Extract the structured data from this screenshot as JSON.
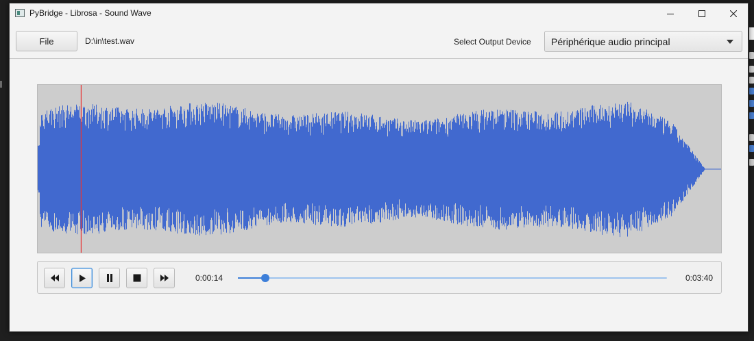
{
  "window": {
    "title": "PyBridge - Librosa - Sound Wave"
  },
  "toolbar": {
    "file_label": "File",
    "file_path": "D:\\in\\test.wav",
    "device_label": "Select Output Device",
    "device_selected": "Périphérique audio principal"
  },
  "waveform": {
    "color": "#4169cf",
    "background": "#cdcdcd",
    "playhead_color": "#e83535",
    "playhead_fraction": 0.0636
  },
  "player": {
    "current_time": "0:00:14",
    "total_time": "0:03:40",
    "progress": 0.0636,
    "accent": "#3d7fd9",
    "buttons": [
      "rewind-icon",
      "play-icon",
      "pause-icon",
      "stop-icon",
      "fast-forward-icon"
    ]
  }
}
